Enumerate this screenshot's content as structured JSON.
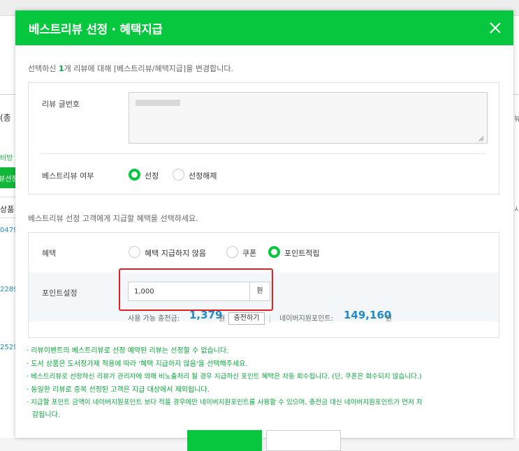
{
  "background": {
    "left_texts": [
      "(총",
      "비방",
      "상품",
      "0479",
      "2289",
      "2529"
    ],
    "green_tab_text": "뷰선정",
    "right_texts": [
      "뷰",
      "시"
    ]
  },
  "modal": {
    "title": "베스트리뷰 선정 · 혜택지급",
    "intro": {
      "before": "선택하신 ",
      "count": "1",
      "after": "개 리뷰에 대해 [베스트리뷰/혜택지급]을 변경합니다."
    },
    "review_number_label": "리뷰 글번호",
    "best_review_label": "베스트리뷰 여부",
    "best_review_options": [
      "선정",
      "선정해제"
    ],
    "benefit_intro": "베스트리뷰 선정 고객에게 지급할 혜택을 선택하세요.",
    "benefit_label": "혜택",
    "benefit_options": [
      "혜택 지급하지 않음",
      "쿠폰",
      "포인트적립"
    ],
    "point_label": "포인트설정",
    "point_value": "1,000",
    "point_unit": "원",
    "available_label": "사용 가능 충전금:",
    "available_amount": "1,379",
    "available_unit": "원",
    "charge_button": "충전하기",
    "naver_point_label": "네이버지원포인트:",
    "naver_point_amount": "149,160",
    "naver_point_unit": "원",
    "notes": [
      "· 리뷰이벤트의 베스트리뷰로 선정 예약된 리뷰는 선정할 수 없습니다.",
      "· 도서 상품은 도서정가제 적용에 따라 '혜택 지급하지 않음'을 선택해주세요.",
      "· 베스트리뷰로 선정하신 리뷰가 관리자에 의해 비노출처리 될 경우 지급하신 포인트 혜택은 자동 회수됩니다. (단, 쿠폰은 회수되지 않습니다.)",
      "· 동일한 리뷰로 중복 선정된 고객은 지급 대상에서 제외됩니다.",
      "· 지급할 포인트 금액이 네이버지원포인트 보다 적을 경우에만 네이버지원포인트를 사용할 수 있으며, 충전금 대신 네이버지원포인트가 먼저 차",
      "감됩니다."
    ]
  },
  "colors": {
    "brand_green": "#06c73d",
    "note_green": "#06a83a",
    "amount_blue": "#1e8ccf",
    "highlight_red": "#e41f1f"
  }
}
